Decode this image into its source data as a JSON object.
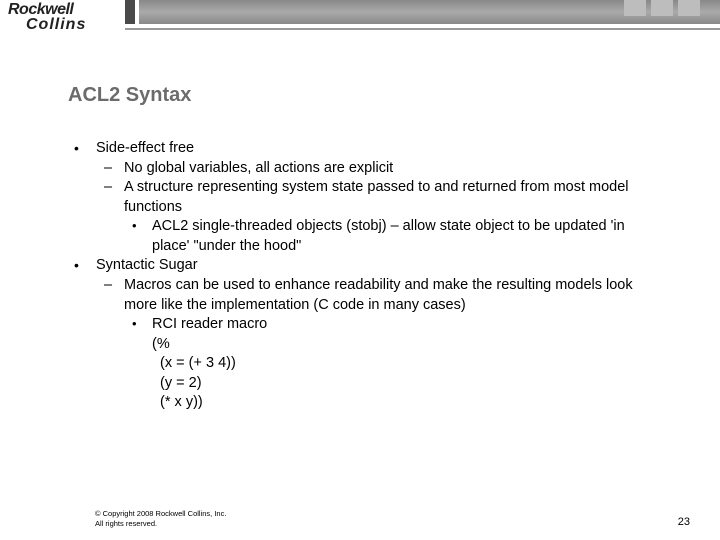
{
  "header": {
    "logo_line1": "Rockwell",
    "logo_line2": "Collins"
  },
  "title": "ACL2 Syntax",
  "outline": {
    "item1": {
      "text": "Side-effect free",
      "sub1": "No global variables, all actions are explicit",
      "sub2": "A structure representing system state passed to and returned from most model functions",
      "sub2_sub1": "ACL2 single-threaded objects (stobj) – allow state object to be updated 'in place' \"under the hood\""
    },
    "item2": {
      "text": "Syntactic Sugar",
      "sub1": "Macros can be used to enhance readability and make the resulting models look more like the implementation (C code in many cases)",
      "sub1_sub1": "RCI reader macro",
      "code": "(%\n  (x = (+ 3 4))\n  (y = 2)\n  (* x y))"
    }
  },
  "footer": {
    "copyright_l1": "© Copyright 2008 Rockwell Collins, Inc.",
    "copyright_l2": "All rights reserved.",
    "page": "23"
  }
}
